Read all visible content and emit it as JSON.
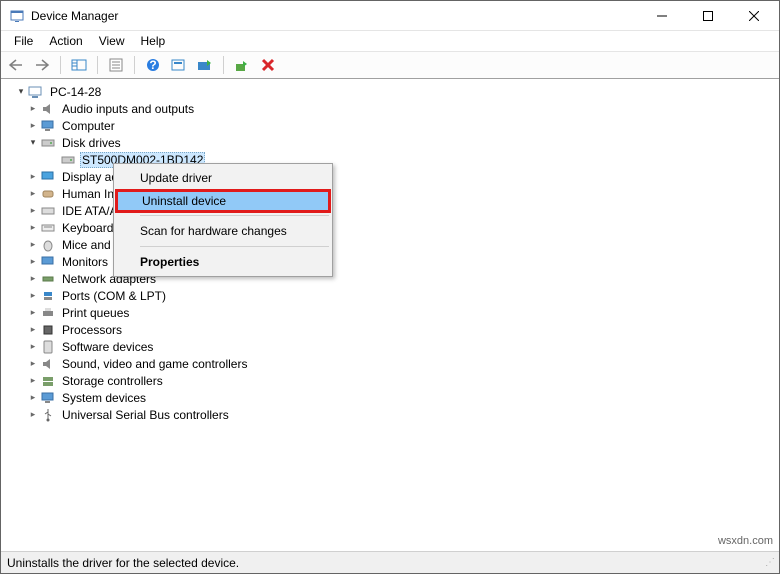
{
  "window": {
    "title": "Device Manager"
  },
  "menus": {
    "file": "File",
    "action": "Action",
    "view": "View",
    "help": "Help"
  },
  "tree": {
    "root": "PC-14-28",
    "items": [
      {
        "label": "Audio inputs and outputs",
        "expanded": false
      },
      {
        "label": "Computer",
        "expanded": false
      },
      {
        "label": "Disk drives",
        "expanded": true,
        "child": "ST500DM002-1BD142"
      },
      {
        "label": "Display adapters",
        "expanded": false
      },
      {
        "label": "Human Interface Devices",
        "expanded": false
      },
      {
        "label": "IDE ATA/ATAPI controllers",
        "expanded": false
      },
      {
        "label": "Keyboards",
        "expanded": false
      },
      {
        "label": "Mice and other pointing devices",
        "expanded": false
      },
      {
        "label": "Monitors",
        "expanded": false
      },
      {
        "label": "Network adapters",
        "expanded": false
      },
      {
        "label": "Ports (COM & LPT)",
        "expanded": false
      },
      {
        "label": "Print queues",
        "expanded": false
      },
      {
        "label": "Processors",
        "expanded": false
      },
      {
        "label": "Software devices",
        "expanded": false
      },
      {
        "label": "Sound, video and game controllers",
        "expanded": false
      },
      {
        "label": "Storage controllers",
        "expanded": false
      },
      {
        "label": "System devices",
        "expanded": false
      },
      {
        "label": "Universal Serial Bus controllers",
        "expanded": false
      }
    ]
  },
  "contextmenu": {
    "update": "Update driver",
    "uninstall": "Uninstall device",
    "scan": "Scan for hardware changes",
    "properties": "Properties"
  },
  "statusbar": {
    "text": "Uninstalls the driver for the selected device."
  },
  "watermark": "wsxdn.com"
}
